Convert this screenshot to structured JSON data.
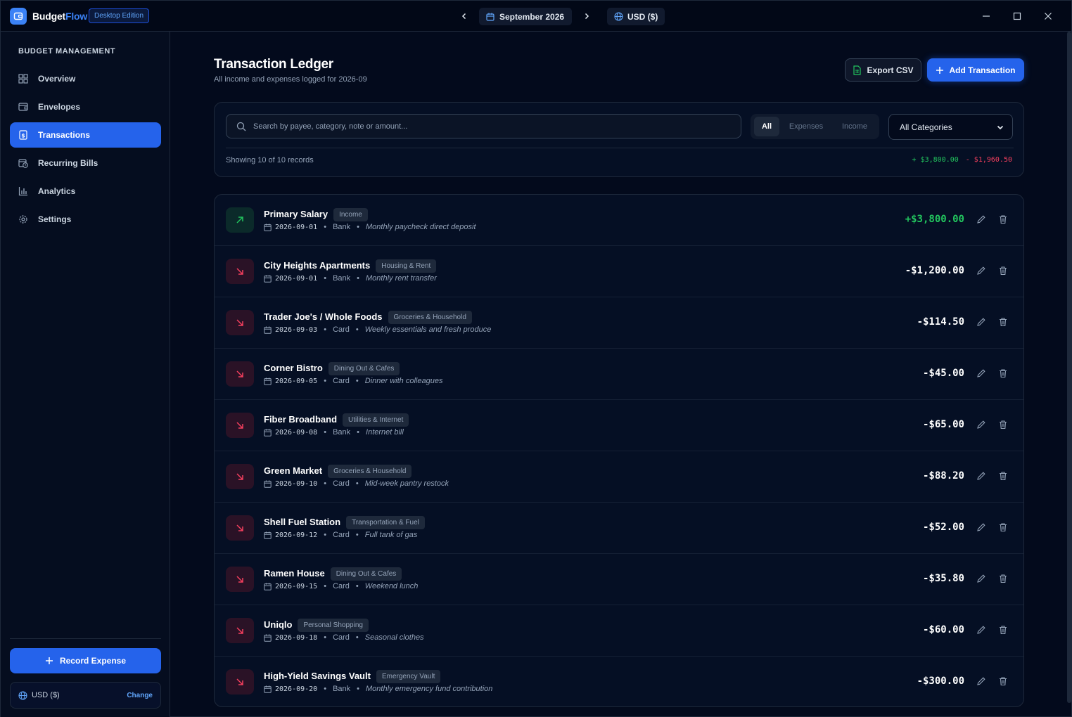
{
  "titlebar": {
    "brand_part1": "Budget",
    "brand_part2": "Flow",
    "edition": "Desktop Edition",
    "month": "September 2026",
    "currency": "USD ($)"
  },
  "sidebar": {
    "heading": "BUDGET MANAGEMENT",
    "items": [
      {
        "label": "Overview",
        "icon": "grid-icon"
      },
      {
        "label": "Envelopes",
        "icon": "envelope-icon"
      },
      {
        "label": "Transactions",
        "icon": "receipt-icon",
        "active": true
      },
      {
        "label": "Recurring Bills",
        "icon": "calendar-clock-icon"
      },
      {
        "label": "Analytics",
        "icon": "bar-chart-icon"
      },
      {
        "label": "Settings",
        "icon": "gear-icon"
      }
    ],
    "record_button": "Record Expense",
    "currency_label": "USD ($)",
    "currency_change": "Change"
  },
  "header": {
    "title": "Transaction Ledger",
    "subtitle": "All income and expenses logged for 2026-09",
    "export_label": "Export CSV",
    "add_label": "Add Transaction"
  },
  "filters": {
    "search_placeholder": "Search by payee, category, note or amount...",
    "segments": [
      "All",
      "Expenses",
      "Income"
    ],
    "active_segment": "All",
    "category_select": "All Categories",
    "showing": "Showing 10 of 10 records",
    "income_total": "+ $3,800.00",
    "expense_total": "- $1,960.50"
  },
  "colors": {
    "accent": "#2563eb",
    "income": "#22c55e",
    "expense": "#f43f5e"
  },
  "transactions": [
    {
      "payee": "Primary Salary",
      "category": "Income",
      "date": "2026-09-01",
      "method": "Bank",
      "note": "Monthly paycheck direct deposit",
      "amount": "+$3,800.00",
      "type": "income"
    },
    {
      "payee": "City Heights Apartments",
      "category": "Housing & Rent",
      "date": "2026-09-01",
      "method": "Bank",
      "note": "Monthly rent transfer",
      "amount": "-$1,200.00",
      "type": "expense"
    },
    {
      "payee": "Trader Joe's / Whole Foods",
      "category": "Groceries & Household",
      "date": "2026-09-03",
      "method": "Card",
      "note": "Weekly essentials and fresh produce",
      "amount": "-$114.50",
      "type": "expense"
    },
    {
      "payee": "Corner Bistro",
      "category": "Dining Out & Cafes",
      "date": "2026-09-05",
      "method": "Card",
      "note": "Dinner with colleagues",
      "amount": "-$45.00",
      "type": "expense"
    },
    {
      "payee": "Fiber Broadband",
      "category": "Utilities & Internet",
      "date": "2026-09-08",
      "method": "Bank",
      "note": "Internet bill",
      "amount": "-$65.00",
      "type": "expense"
    },
    {
      "payee": "Green Market",
      "category": "Groceries & Household",
      "date": "2026-09-10",
      "method": "Card",
      "note": "Mid-week pantry restock",
      "amount": "-$88.20",
      "type": "expense"
    },
    {
      "payee": "Shell Fuel Station",
      "category": "Transportation & Fuel",
      "date": "2026-09-12",
      "method": "Card",
      "note": "Full tank of gas",
      "amount": "-$52.00",
      "type": "expense"
    },
    {
      "payee": "Ramen House",
      "category": "Dining Out & Cafes",
      "date": "2026-09-15",
      "method": "Card",
      "note": "Weekend lunch",
      "amount": "-$35.80",
      "type": "expense"
    },
    {
      "payee": "Uniqlo",
      "category": "Personal Shopping",
      "date": "2026-09-18",
      "method": "Card",
      "note": "Seasonal clothes",
      "amount": "-$60.00",
      "type": "expense"
    },
    {
      "payee": "High-Yield Savings Vault",
      "category": "Emergency Vault",
      "date": "2026-09-20",
      "method": "Bank",
      "note": "Monthly emergency fund contribution",
      "amount": "-$300.00",
      "type": "expense"
    }
  ]
}
